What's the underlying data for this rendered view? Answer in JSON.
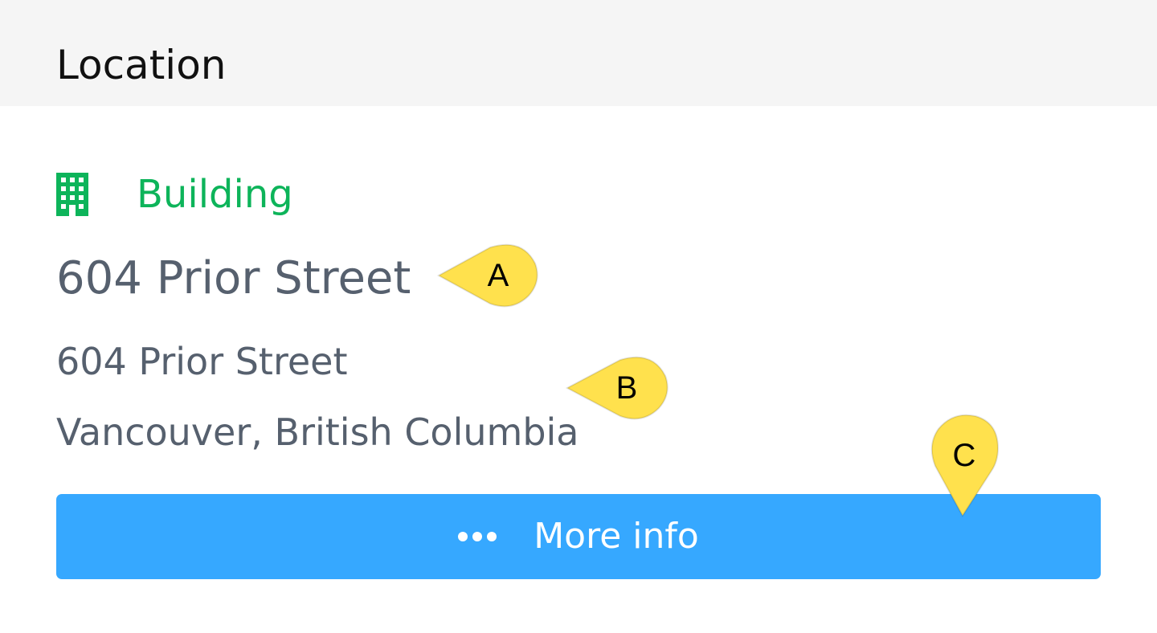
{
  "header": {
    "title": "Location"
  },
  "location": {
    "type_icon": "building-icon",
    "type_label": "Building",
    "name": "604 Prior Street",
    "address_line1": "604 Prior Street",
    "address_line2": "Vancouver, British Columbia"
  },
  "actions": {
    "more_info_icon": "ellipsis-icon",
    "more_info_label": "More info"
  },
  "callouts": {
    "a": "A",
    "b": "B",
    "c": "C"
  },
  "colors": {
    "header_bg": "#f5f5f5",
    "accent_green": "#0db45a",
    "text_slate": "#56606e",
    "button_blue": "#36a8ff",
    "callout_yellow": "#ffe14d"
  }
}
